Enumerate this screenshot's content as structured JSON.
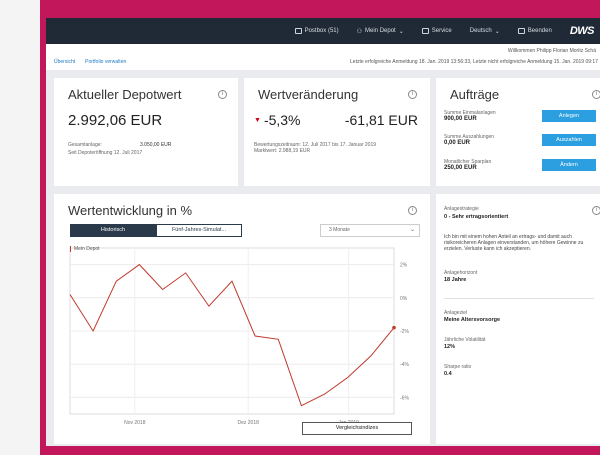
{
  "topbar": {
    "postbox": "Postbox (51)",
    "depot": "Mein Depot",
    "service": "Service",
    "language": "Deutsch",
    "logout": "Beenden",
    "logo": "DWS"
  },
  "subbar": {
    "welcome": "Willkommen Philipp Florian Moritz Schä",
    "nav_overview": "Übersicht",
    "nav_portfolio": "Portfolio verwalten",
    "last_login": "Letzte erfolgreiche Anmeldung 18. Jan. 2019 13:56:33, Letzte nicht erfolgreiche Anmeldung 15. Jan. 2019 09:17"
  },
  "depot_value": {
    "title": "Aktueller Depotwert",
    "value": "2.992,06 EUR",
    "invest_label": "Gesamtanlage:",
    "invest_value": "3.050,00 EUR",
    "opened": "Seit Depoteröffnung 12. Juli 2017"
  },
  "change": {
    "title": "Wertveränderung",
    "percent": "-5,3%",
    "amount": "-61,81 EUR",
    "period": "Bewertungszeitraum: 12. Juli 2017 bis 17. Januar 2019",
    "market_value": "Marktwert: 2.988,19 EUR"
  },
  "orders": {
    "title": "Aufträge",
    "deposits_label": "Summe Einmalanlagen",
    "deposits_value": "900,00 EUR",
    "deposits_btn": "Anlegen",
    "withdrawals_label": "Summe Auszahlungen",
    "withdrawals_value": "0,00 EUR",
    "withdrawals_btn": "Auszahlen",
    "savings_label": "Monatlicher Sparplan",
    "savings_value": "250,00 EUR",
    "savings_btn": "Ändern"
  },
  "chart_panel": {
    "title": "Wertentwicklung in %",
    "tab_historic": "Historisch",
    "tab_forecast": "Fünf-Jahres-Simulat...",
    "range": "3 Monate",
    "legend": "Mein Depot",
    "compare_btn": "Vergleichsindizes"
  },
  "chart_data": {
    "type": "line",
    "x_ticks": [
      "Nov 2018",
      "Dez 2018",
      "Jan 2019"
    ],
    "y_ticks": [
      "2%",
      "0%",
      "-2%",
      "-4%",
      "-6%"
    ],
    "ylim": [
      -7,
      3
    ],
    "grid": true,
    "legend_position": "top-left",
    "series": [
      {
        "name": "Mein Depot",
        "color": "#c0392b",
        "values": [
          0.2,
          -2.0,
          1.0,
          2.0,
          0.5,
          1.5,
          -0.5,
          1.0,
          -2.3,
          -2.5,
          -6.5,
          -5.8,
          -4.8,
          -3.5,
          -1.8
        ]
      }
    ]
  },
  "strategy": {
    "strategy_label": "Anlagestrategie",
    "strategy_value": "0 - Sehr ertragsorientiert",
    "desc": "Ich bin mit einem hohen Anteil an ertrags- und damit auch risikoreicheren Anlagen einverstanden, um höhere Gewinne zu erzielen. Verluste kann ich akzeptieren.",
    "horizon_label": "Anlagehorizont",
    "horizon_value": "18 Jahre",
    "goal_label": "Anlageziel",
    "goal_value": "Meine Altersvorsorge",
    "vol_label": "Jährliche Volatilität",
    "vol_value": "12%",
    "sharpe_label": "Sharpe ratio",
    "sharpe_value": "0.4"
  },
  "colors": {
    "accent": "#2b9fe0",
    "negative": "#d0021b",
    "brand_magenta": "#c2185b",
    "navbar": "#1f2a36"
  }
}
